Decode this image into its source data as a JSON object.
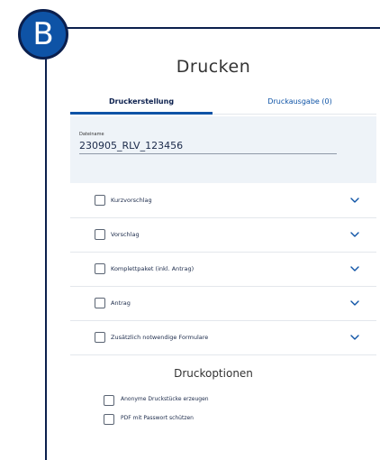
{
  "badge_letter": "B",
  "title": "Drucken",
  "tabs": [
    {
      "label": "Druckerstellung",
      "active": true
    },
    {
      "label": "Druckausgabe (0)",
      "active": false
    }
  ],
  "filename": {
    "label": "Dateiname",
    "value": "230905_RLV_123456"
  },
  "sections": [
    {
      "label": "Kurzvorschlag",
      "checked": false
    },
    {
      "label": "Vorschlag",
      "checked": false
    },
    {
      "label": "Komplettpaket (inkl. Antrag)",
      "checked": false
    },
    {
      "label": "Antrag",
      "checked": false
    },
    {
      "label": "Zusätzlich notwendige Formulare",
      "checked": false
    }
  ],
  "print_options": {
    "title": "Druckoptionen",
    "items": [
      {
        "label": "Anonyme Druckstücke erzeugen",
        "checked": false
      },
      {
        "label": "PDF mit Passwort schützen",
        "checked": false
      }
    ]
  },
  "icons": {
    "section_toggle": "chevron-down-icon"
  },
  "colors": {
    "accent": "#0e53a6",
    "frame": "#0b1f4d",
    "panel_bg": "#eef3f8",
    "divider": "#e3e7ec"
  }
}
